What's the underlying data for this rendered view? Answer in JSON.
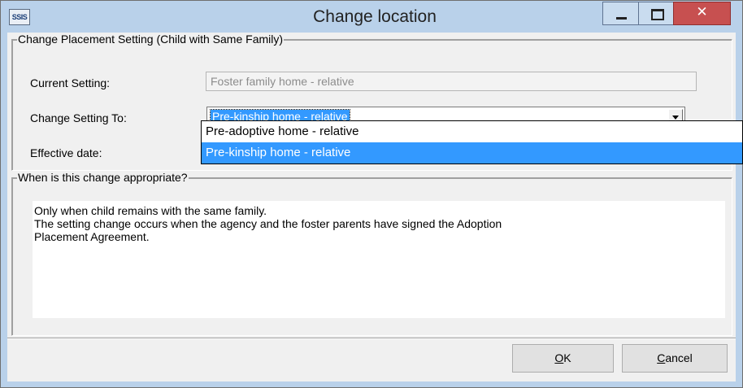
{
  "window": {
    "app_icon_text": "SSIS",
    "title": "Change location"
  },
  "placement_group": {
    "legend": "Change Placement Setting (Child with Same Family)",
    "current_setting_label": "Current Setting:",
    "current_setting_value": "Foster family home - relative",
    "change_setting_label": "Change Setting To:",
    "change_setting_value": "Pre-kinship home - relative",
    "effective_date_label": "Effective date:"
  },
  "dropdown": {
    "options": [
      "Pre-adoptive home - relative",
      "Pre-kinship home - relative"
    ],
    "selected_index": 1
  },
  "help_group": {
    "legend": "When is this change appropriate?",
    "lines": [
      "Only when child remains with the same family.",
      "The setting change occurs when the agency and the foster parents have signed the Adoption",
      "Placement Agreement."
    ]
  },
  "buttons": {
    "ok_mnemonic": "O",
    "ok_rest": "K",
    "cancel_mnemonic": "C",
    "cancel_rest": "ancel"
  },
  "colors": {
    "title_bar": "#b9d1ea",
    "selection": "#3399ff",
    "close_button": "#c75050"
  }
}
